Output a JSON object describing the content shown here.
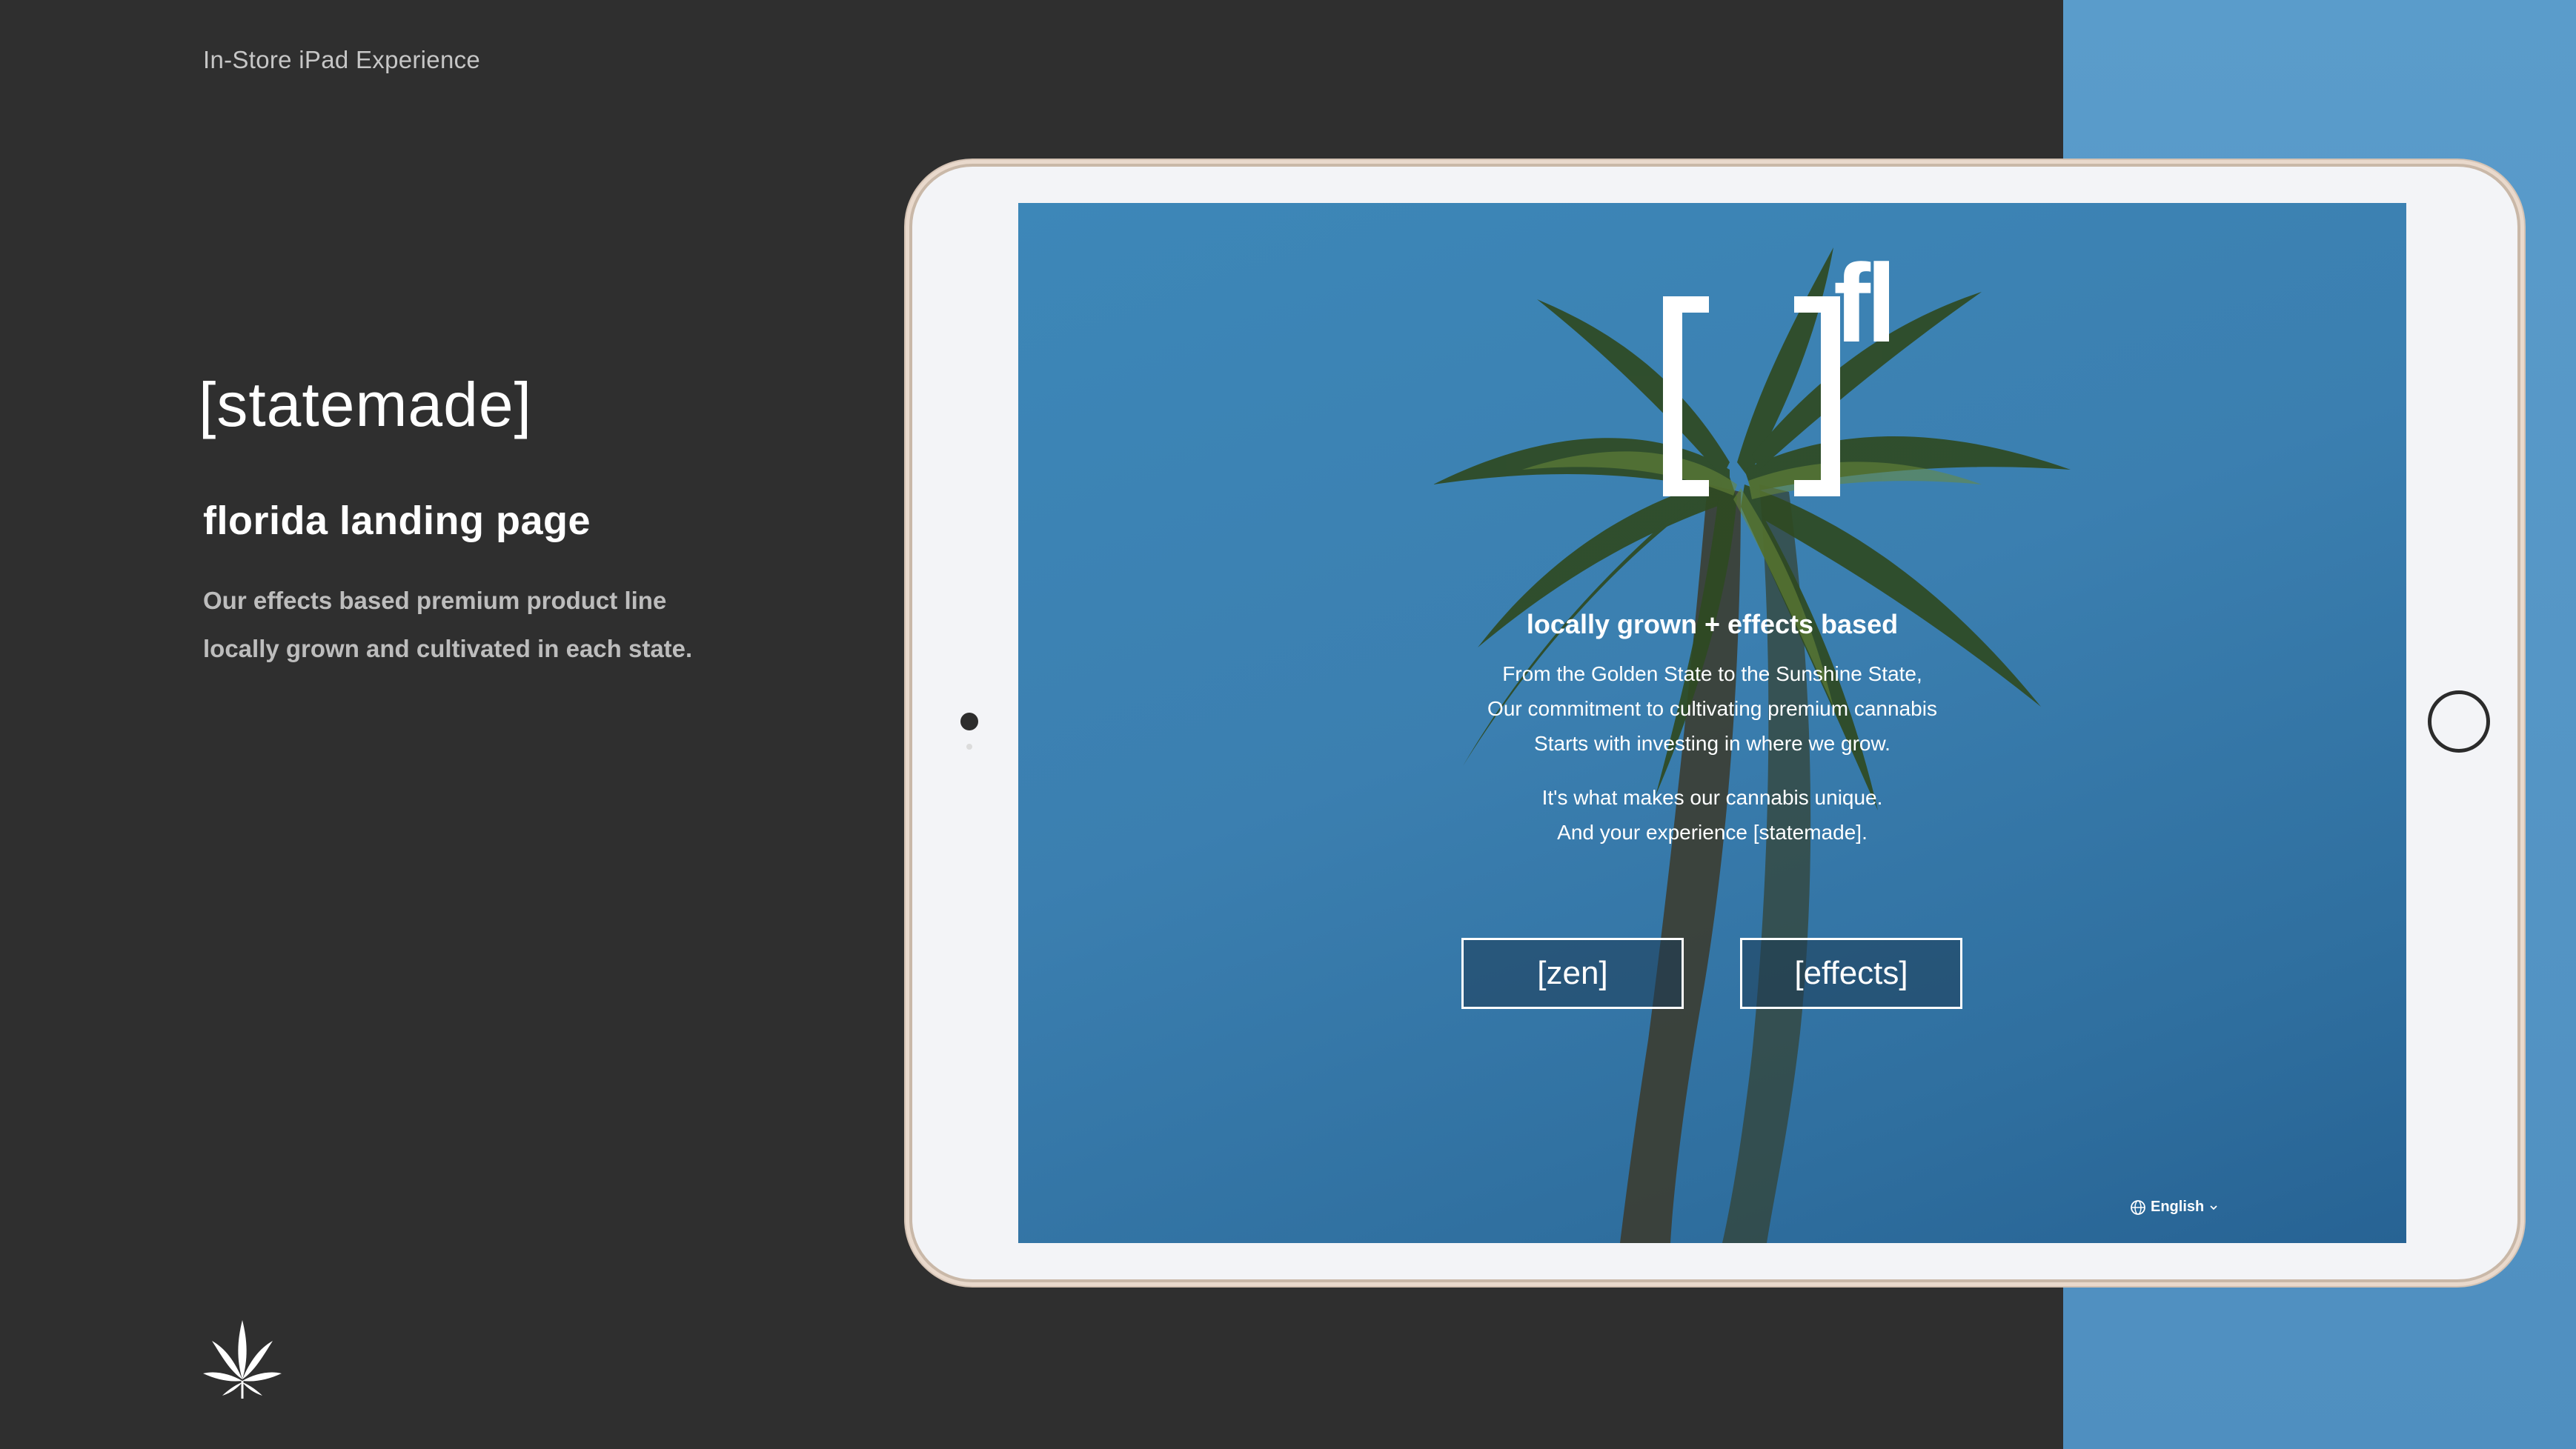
{
  "caption": "In-Store iPad Experience",
  "brand": "[statemade]",
  "page_heading": "florida landing page",
  "description_lines": [
    "Our effects based premium product line",
    "locally grown and cultivated in each state."
  ],
  "screen": {
    "logo_superscript": "fl",
    "tagline": "locally grown + effects based",
    "paragraph1": [
      "From the Golden State to the Sunshine State,",
      "Our commitment to cultivating premium cannabis",
      "Starts with investing in where we grow."
    ],
    "paragraph2": [
      "It's what makes our cannabis unique.",
      "And your experience [statemade]."
    ],
    "buttons": {
      "zen": "[zen]",
      "effects": "[effects]"
    },
    "language": "English"
  },
  "colors": {
    "background": "#2f2f2f",
    "accent_blue": "#5a9ccb",
    "ipad_frame": "#f3f4f7"
  },
  "icons": [
    "cannabis-leaf-icon",
    "globe-icon",
    "chevron-down-icon"
  ]
}
